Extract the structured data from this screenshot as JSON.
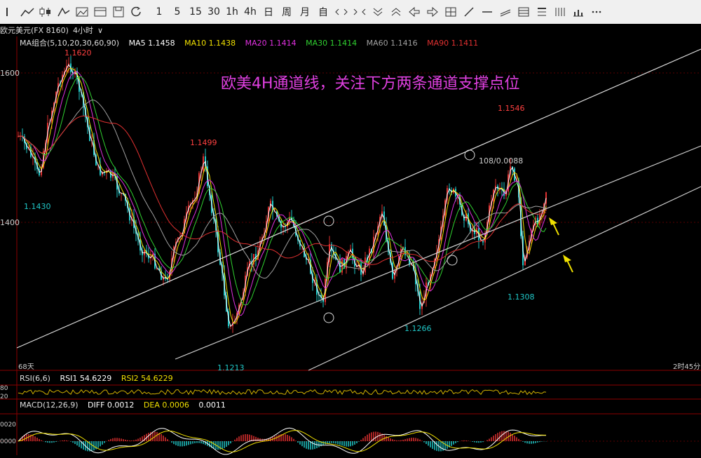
{
  "toolbar": {
    "period_1": "1",
    "period_5": "5",
    "period_15": "15",
    "period_30": "30",
    "period_1h": "1h",
    "period_4h": "4h",
    "period_day": "日",
    "period_week": "周",
    "period_month": "月",
    "period_custom": "自"
  },
  "header": {
    "symbol": "欧元美元(FX 8160)",
    "timeframe": "4小时"
  },
  "ma_legend": {
    "label": "MA组合(5,10,20,30,60,90)",
    "items": [
      {
        "text": "MA5 1.1458",
        "color": "#ffffff"
      },
      {
        "text": "MA10 1.1438",
        "color": "#f0e000"
      },
      {
        "text": "MA20 1.1414",
        "color": "#e030e0"
      },
      {
        "text": "MA30 1.1414",
        "color": "#30d030"
      },
      {
        "text": "MA60 1.1416",
        "color": "#a0a0a0"
      },
      {
        "text": "MA90 1.1411",
        "color": "#e03030"
      }
    ]
  },
  "annotation": "欧美4H通道线，关注下方两条通道支撑点位",
  "price_labels": {
    "p1620": "1.1620",
    "p1499": "1.1499",
    "p1546": "1.1546",
    "p1430": "1.1430",
    "p1308": "1.1308",
    "p1266": "1.1266",
    "p1213": "1.1213",
    "measure": "108/0.0088"
  },
  "axis": {
    "y_top": "1600",
    "y_mid": "1400",
    "left_days": "68天",
    "right_time": "2时45分"
  },
  "rsi": {
    "label": "RSI(6,6)",
    "rsi1": "RSI1 54.6229",
    "rsi2": "RSI2 54.6229",
    "tick_80": "80",
    "tick_20": "20"
  },
  "macd": {
    "label": "MACD(12,26,9)",
    "diff": "DIFF 0.0012",
    "dea": "DEA 0.0006",
    "macd": "0.0011",
    "tick_top": "0020",
    "tick_zero": "0000"
  },
  "colors": {
    "up": "#e03030",
    "down": "#20c8c8",
    "annotation": "#e040e0",
    "arrow": "#f0e000"
  }
}
